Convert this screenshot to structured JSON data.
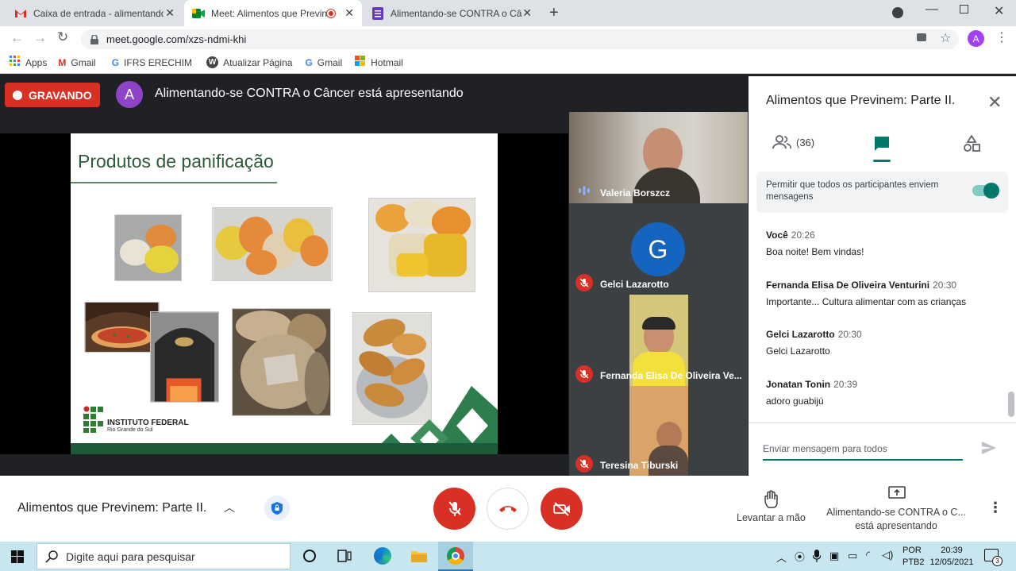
{
  "browser": {
    "tabs": [
      {
        "title": "Caixa de entrada - alimentando-s",
        "favicon": "gmail-icon"
      },
      {
        "title": "Meet: Alimentos que Previne",
        "favicon": "meet-icon",
        "recording": true
      },
      {
        "title": "Alimentando-se CONTRA o Cânc",
        "favicon": "forms-icon"
      }
    ],
    "url": "meet.google.com/xzs-ndmi-khi",
    "profile_initial": "A",
    "bookmarks": [
      {
        "label": "Apps",
        "icon": "apps-grid-icon"
      },
      {
        "label": "Gmail",
        "icon": "gmail-icon"
      },
      {
        "label": "IFRS ERECHIM",
        "icon": "google-icon"
      },
      {
        "label": "Atualizar Página",
        "icon": "wordpress-icon"
      },
      {
        "label": "Gmail",
        "icon": "google-icon"
      },
      {
        "label": "Hotmail",
        "icon": "windows-icon"
      }
    ]
  },
  "meet": {
    "recording_label": "GRAVANDO",
    "presenter_initial": "A",
    "presenting_text": "Alimentando-se CONTRA o Câncer está apresentando",
    "slide": {
      "title": "Produtos de panificação",
      "institution_line1": "INSTITUTO FEDERAL",
      "institution_line2": "Rio Grande do Sul"
    },
    "participants": [
      {
        "name": "Valeria Borszcz",
        "speaking": true
      },
      {
        "name": "Gelci Lazarotto",
        "initial": "G",
        "muted": true
      },
      {
        "name": "Fernanda Elisa De Oliveira Ve...",
        "muted": true
      },
      {
        "name": "Teresina Tiburski",
        "muted": true
      }
    ],
    "panel": {
      "title": "Alimentos que Previnem: Parte II.",
      "people_count": "(36)",
      "permit_text": "Permitir que todos os participantes enviem mensagens",
      "messages": [
        {
          "author": "Você",
          "time": "20:26",
          "text": "Boa noite! Bem vindas!"
        },
        {
          "author": "Fernanda Elisa De Oliveira Venturini",
          "time": "20:30",
          "text": "Importante... Cultura alimentar com as crianças"
        },
        {
          "author": "Gelci Lazarotto",
          "time": "20:30",
          "text": "Gelci Lazarotto"
        },
        {
          "author": "Jonatan Tonin",
          "time": "20:39",
          "text": "adoro guabijú"
        }
      ],
      "input_placeholder": "Enviar mensagem para todos"
    },
    "bottom": {
      "meeting_name": "Alimentos que Previnem: Parte II.",
      "raise_hand": "Levantar a mão",
      "presenting_line1": "Alimentando-se CONTRA o C...",
      "presenting_line2": "está apresentando"
    }
  },
  "taskbar": {
    "search_placeholder": "Digite aqui para pesquisar",
    "lang1": "POR",
    "lang2": "PTB2",
    "time": "20:39",
    "date": "12/05/2021",
    "notifications": "3"
  },
  "colors": {
    "accent": "#00796b",
    "record_red": "#d93025",
    "presenter_purple": "#8e44c9",
    "meet_blue": "#1a73e8"
  }
}
